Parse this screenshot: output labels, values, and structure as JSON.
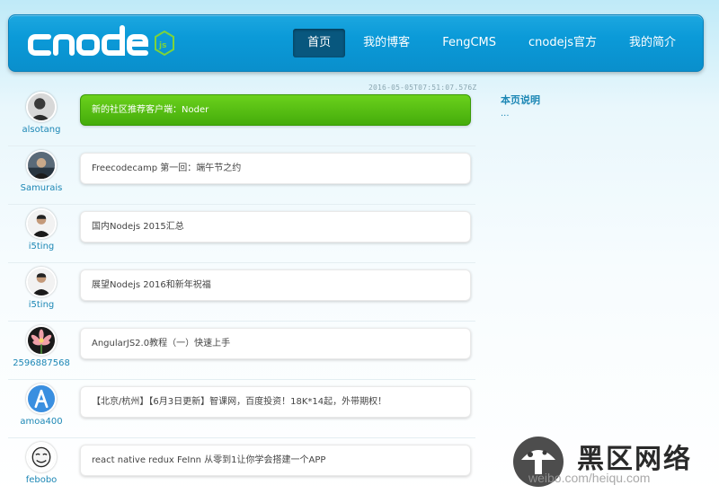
{
  "header": {
    "logo_alt": "cnode js",
    "nav": [
      {
        "label": "首页",
        "active": true
      },
      {
        "label": "我的博客",
        "active": false
      },
      {
        "label": "FengCMS",
        "active": false
      },
      {
        "label": "cnodejs官方",
        "active": false
      },
      {
        "label": "我的简介",
        "active": false
      }
    ]
  },
  "timestamp": "2016-05-05T07:51:07.576Z",
  "topics": [
    {
      "author": "alsotang",
      "title": "新的社区推荐客户端：Noder",
      "highlight": true
    },
    {
      "author": "Samurais",
      "title": "Freecodecamp 第一回：端午节之约",
      "highlight": false
    },
    {
      "author": "i5ting",
      "title": "国内Nodejs 2015汇总",
      "highlight": false
    },
    {
      "author": "i5ting",
      "title": "展望Nodejs 2016和新年祝福",
      "highlight": false
    },
    {
      "author": "2596887568",
      "title": "AngularJS2.0教程（一）快速上手",
      "highlight": false
    },
    {
      "author": "amoa400",
      "title": "【北京/杭州】【6月3日更新】智课网，百度投资！18K*14起，外带期权！",
      "highlight": false
    },
    {
      "author": "febobo",
      "title": "react native redux FeInn 从零到1让你学会搭建一个APP",
      "highlight": false
    }
  ],
  "sidebar": {
    "title": "本页说明",
    "text": "..."
  },
  "watermark": {
    "name": "黑区网络",
    "site": "weibo.com/heiqu.com"
  },
  "colors": {
    "header_blue": "#0b9ad8",
    "active_nav": "#08577e",
    "highlight_green": "#52bb10",
    "link_blue": "#1c87b5"
  }
}
